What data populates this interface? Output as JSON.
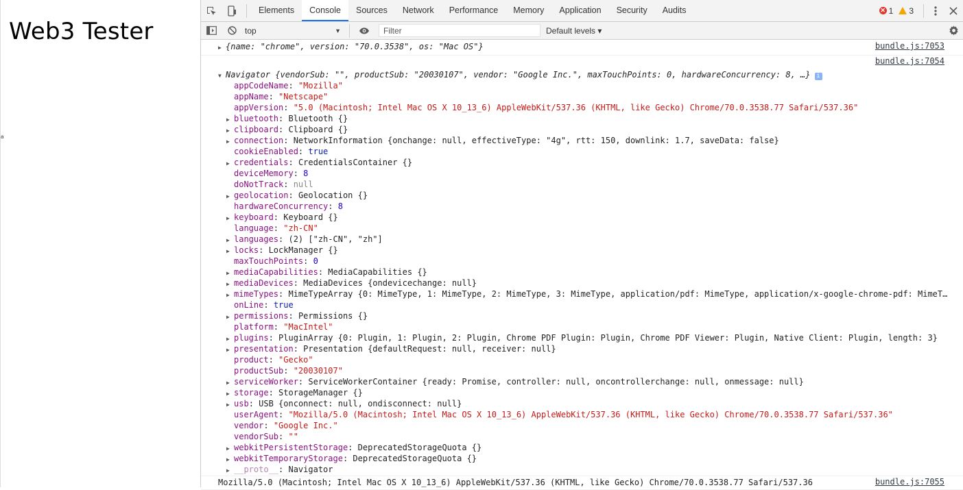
{
  "page": {
    "title": "Web3 Tester"
  },
  "devtools": {
    "tabs": [
      "Elements",
      "Console",
      "Sources",
      "Network",
      "Performance",
      "Memory",
      "Application",
      "Security",
      "Audits"
    ],
    "active_tab": "Console",
    "error_count": "1",
    "warning_count": "3",
    "context": "top",
    "filter_placeholder": "Filter",
    "levels": "Default levels ▾"
  },
  "console": {
    "msg1": {
      "source": "bundle.js:7053",
      "text": "{name: \"chrome\", version: \"70.0.3538\", os: \"Mac OS\"}"
    },
    "msg2": {
      "source": "bundle.js:7054",
      "header": "Navigator {vendorSub: \"\", productSub: \"20030107\", vendor: \"Google Inc.\", maxTouchPoints: 0, hardwareConcurrency: 8, …}",
      "props": [
        {
          "expandable": false,
          "key": "appCodeName",
          "value": "\"Mozilla\"",
          "kind": "s"
        },
        {
          "expandable": false,
          "key": "appName",
          "value": "\"Netscape\"",
          "kind": "s"
        },
        {
          "expandable": false,
          "key": "appVersion",
          "value": "\"5.0 (Macintosh; Intel Mac OS X 10_13_6) AppleWebKit/537.36 (KHTML, like Gecko) Chrome/70.0.3538.77 Safari/537.36\"",
          "kind": "s"
        },
        {
          "expandable": true,
          "key": "bluetooth",
          "value": "Bluetooth {}",
          "kind": "o"
        },
        {
          "expandable": true,
          "key": "clipboard",
          "value": "Clipboard {}",
          "kind": "o"
        },
        {
          "expandable": true,
          "key": "connection",
          "value": "NetworkInformation {onchange: null, effectiveType: \"4g\", rtt: 150, downlink: 1.7, saveData: false}",
          "kind": "o"
        },
        {
          "expandable": false,
          "key": "cookieEnabled",
          "value": "true",
          "kind": "kw"
        },
        {
          "expandable": true,
          "key": "credentials",
          "value": "CredentialsContainer {}",
          "kind": "o"
        },
        {
          "expandable": false,
          "key": "deviceMemory",
          "value": "8",
          "kind": "n"
        },
        {
          "expandable": false,
          "key": "doNotTrack",
          "value": "null",
          "kind": "g"
        },
        {
          "expandable": true,
          "key": "geolocation",
          "value": "Geolocation {}",
          "kind": "o"
        },
        {
          "expandable": false,
          "key": "hardwareConcurrency",
          "value": "8",
          "kind": "n"
        },
        {
          "expandable": true,
          "key": "keyboard",
          "value": "Keyboard {}",
          "kind": "o"
        },
        {
          "expandable": false,
          "key": "language",
          "value": "\"zh-CN\"",
          "kind": "s"
        },
        {
          "expandable": true,
          "key": "languages",
          "value": "(2) [\"zh-CN\", \"zh\"]",
          "kind": "o"
        },
        {
          "expandable": true,
          "key": "locks",
          "value": "LockManager {}",
          "kind": "o"
        },
        {
          "expandable": false,
          "key": "maxTouchPoints",
          "value": "0",
          "kind": "n"
        },
        {
          "expandable": true,
          "key": "mediaCapabilities",
          "value": "MediaCapabilities {}",
          "kind": "o"
        },
        {
          "expandable": true,
          "key": "mediaDevices",
          "value": "MediaDevices {ondevicechange: null}",
          "kind": "o"
        },
        {
          "expandable": true,
          "key": "mimeTypes",
          "value": "MimeTypeArray {0: MimeType, 1: MimeType, 2: MimeType, 3: MimeType, application/pdf: MimeType, application/x-google-chrome-pdf: MimeT…",
          "kind": "o"
        },
        {
          "expandable": false,
          "key": "onLine",
          "value": "true",
          "kind": "kw"
        },
        {
          "expandable": true,
          "key": "permissions",
          "value": "Permissions {}",
          "kind": "o"
        },
        {
          "expandable": false,
          "key": "platform",
          "value": "\"MacIntel\"",
          "kind": "s"
        },
        {
          "expandable": true,
          "key": "plugins",
          "value": "PluginArray {0: Plugin, 1: Plugin, 2: Plugin, Chrome PDF Plugin: Plugin, Chrome PDF Viewer: Plugin, Native Client: Plugin, length: 3}",
          "kind": "o"
        },
        {
          "expandable": true,
          "key": "presentation",
          "value": "Presentation {defaultRequest: null, receiver: null}",
          "kind": "o"
        },
        {
          "expandable": false,
          "key": "product",
          "value": "\"Gecko\"",
          "kind": "s"
        },
        {
          "expandable": false,
          "key": "productSub",
          "value": "\"20030107\"",
          "kind": "s"
        },
        {
          "expandable": true,
          "key": "serviceWorker",
          "value": "ServiceWorkerContainer {ready: Promise, controller: null, oncontrollerchange: null, onmessage: null}",
          "kind": "o"
        },
        {
          "expandable": true,
          "key": "storage",
          "value": "StorageManager {}",
          "kind": "o"
        },
        {
          "expandable": true,
          "key": "usb",
          "value": "USB {onconnect: null, ondisconnect: null}",
          "kind": "o"
        },
        {
          "expandable": false,
          "key": "userAgent",
          "value": "\"Mozilla/5.0 (Macintosh; Intel Mac OS X 10_13_6) AppleWebKit/537.36 (KHTML, like Gecko) Chrome/70.0.3538.77 Safari/537.36\"",
          "kind": "s"
        },
        {
          "expandable": false,
          "key": "vendor",
          "value": "\"Google Inc.\"",
          "kind": "s"
        },
        {
          "expandable": false,
          "key": "vendorSub",
          "value": "\"\"",
          "kind": "s"
        },
        {
          "expandable": true,
          "key": "webkitPersistentStorage",
          "value": "DeprecatedStorageQuota {}",
          "kind": "o"
        },
        {
          "expandable": true,
          "key": "webkitTemporaryStorage",
          "value": "DeprecatedStorageQuota {}",
          "kind": "o"
        },
        {
          "expandable": true,
          "key": "__proto__",
          "value": "Navigator",
          "kind": "o"
        }
      ]
    },
    "msg3": {
      "source": "bundle.js:7055",
      "text": "Mozilla/5.0 (Macintosh; Intel Mac OS X 10_13_6) AppleWebKit/537.36 (KHTML, like Gecko) Chrome/70.0.3538.77 Safari/537.36"
    }
  }
}
